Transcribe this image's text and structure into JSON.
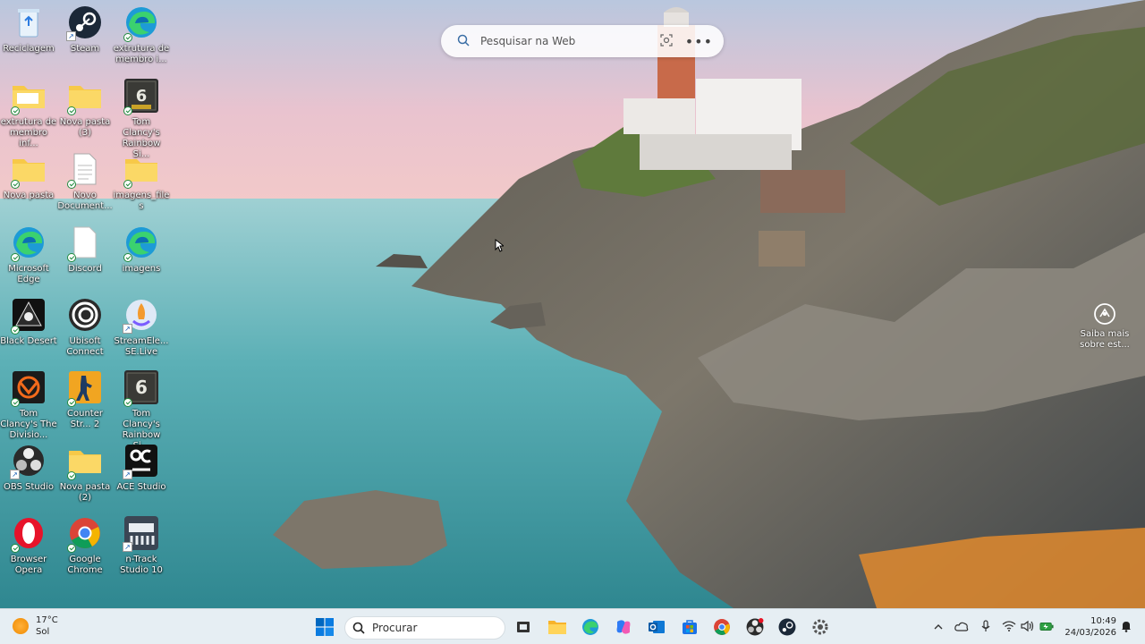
{
  "desktop": {
    "icons": [
      {
        "label": "Reciclagem"
      },
      {
        "label": "Steam"
      },
      {
        "label": "extrutura de membro i..."
      },
      {
        "label": "extrutura de membro inf..."
      },
      {
        "label": "Nova pasta (3)"
      },
      {
        "label": "Tom Clancy's Rainbow Si..."
      },
      {
        "label": "Nova pasta"
      },
      {
        "label": "Novo Document..."
      },
      {
        "label": "imagens_files"
      },
      {
        "label": "Microsoft Edge"
      },
      {
        "label": "Discord"
      },
      {
        "label": "imagens"
      },
      {
        "label": "Black Desert"
      },
      {
        "label": "Ubisoft Connect"
      },
      {
        "label": "StreamEle... SE.Live"
      },
      {
        "label": "Tom Clancy's The Divisio..."
      },
      {
        "label": "Counter Str... 2"
      },
      {
        "label": "Tom Clancy's Rainbow Si..."
      },
      {
        "label": "OBS Studio"
      },
      {
        "label": "Nova pasta (2)"
      },
      {
        "label": "ACE Studio"
      },
      {
        "label": "Browser Opera"
      },
      {
        "label": "Google Chrome"
      },
      {
        "label": "n-Track Studio 10"
      }
    ]
  },
  "web_search": {
    "placeholder": "Pesquisar na Web"
  },
  "learn_more": {
    "label": "Saiba mais sobre est..."
  },
  "taskbar": {
    "weather": {
      "temp": "17°C",
      "condition": "Sol"
    },
    "search_label": "Procurar",
    "clock": {
      "time": "10:49",
      "date": "24/03/2026"
    }
  },
  "colors": {
    "taskbar_bg": "#e6eef3",
    "folder": "#f7c948",
    "accent": "#0067c0"
  }
}
